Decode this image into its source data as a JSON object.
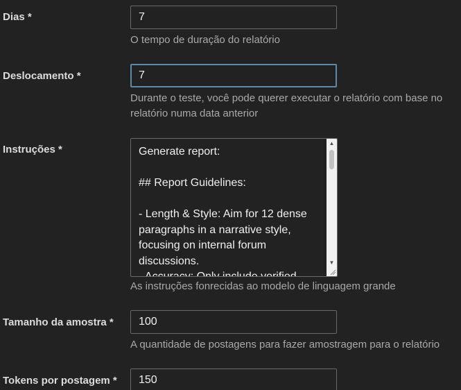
{
  "form": {
    "days": {
      "label": "Dias *",
      "value": "7",
      "help": "O tempo de duração do relatório"
    },
    "offset": {
      "label": "Deslocamento *",
      "value": "7",
      "help_line1": "Durante o teste, você pode querer executar o relatório com base no",
      "help_line2": "relatório numa data anterior"
    },
    "instructions": {
      "label": "Instruções *",
      "value": "Generate report:\n\n## Report Guidelines:\n\n- Length & Style: Aim for 12 dense paragraphs in a narrative style, focusing on internal forum discussions.\n- Accuracy: Only include verified",
      "help": "As instruções fonrecidas ao modelo de linguagem grande"
    },
    "sample_size": {
      "label": "Tamanho da amostra *",
      "value": "100",
      "help": "A quantidade de postagens para fazer amostragem para o relatório"
    },
    "tokens_per_post": {
      "label": "Tokens por postagem *",
      "value": "150"
    }
  }
}
